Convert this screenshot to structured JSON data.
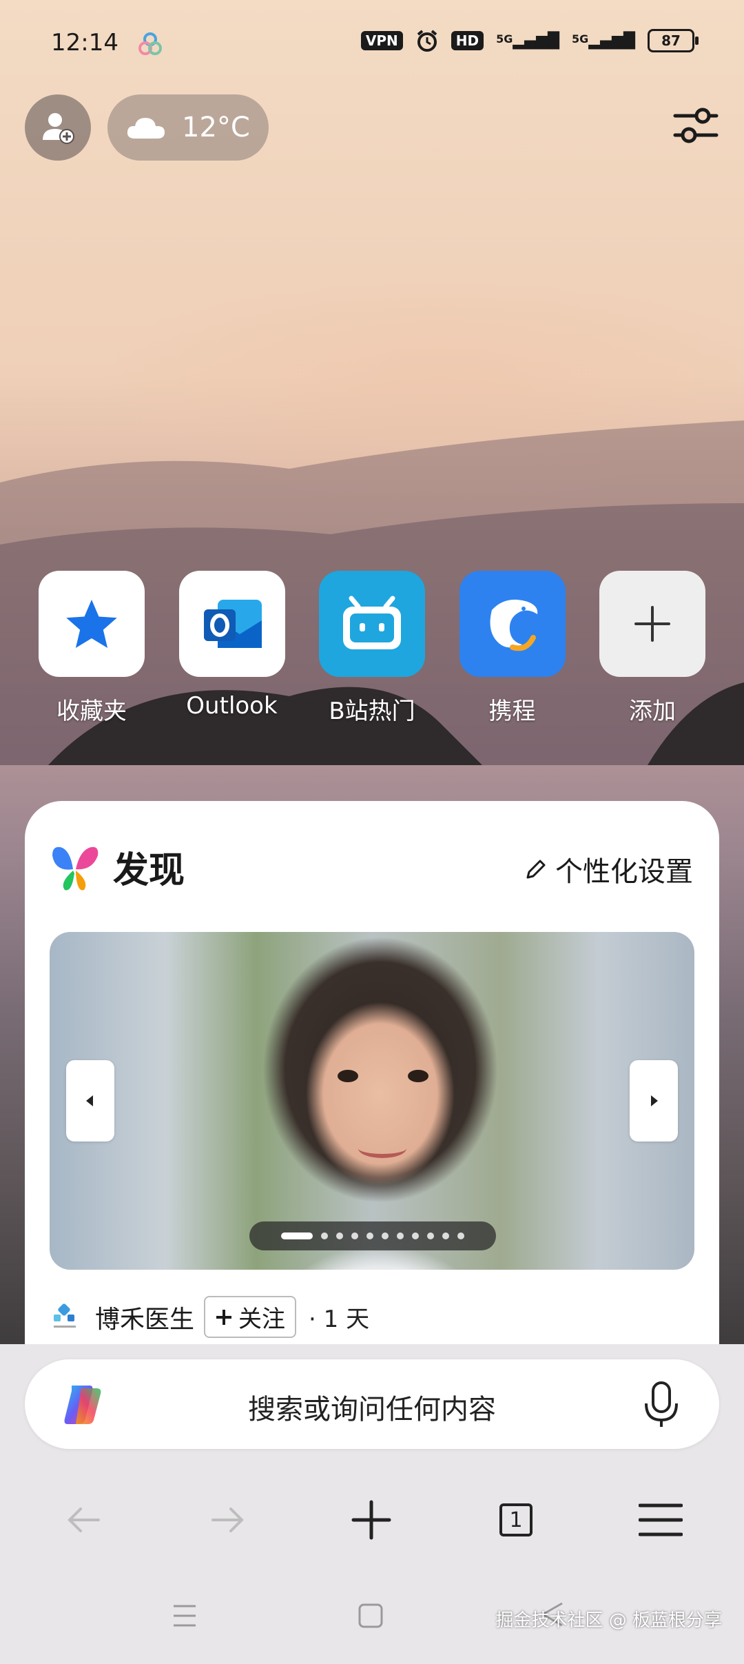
{
  "status_bar": {
    "time": "12:14",
    "vpn": "VPN",
    "hd": "HD",
    "signal1": "5G",
    "signal2": "5G",
    "battery": "87"
  },
  "weather": {
    "temp": "12°C",
    "icon": "cloud-icon"
  },
  "shortcuts": [
    {
      "label": "收藏夹",
      "icon": "star-icon",
      "bg": "#ffffff",
      "fg": "#1a73e8"
    },
    {
      "label": "Outlook",
      "icon": "outlook-icon",
      "bg": "#ffffff",
      "fg": "#0a64c8"
    },
    {
      "label": "B站热门",
      "icon": "bilibili-icon",
      "bg": "#1fa6de",
      "fg": "#ffffff"
    },
    {
      "label": "携程",
      "icon": "ctrip-dolphin-icon",
      "bg": "#2d82f0",
      "fg": "#ffffff"
    },
    {
      "label": "添加",
      "icon": "plus-icon",
      "bg": "#efeeef",
      "fg": "#333333"
    }
  ],
  "discover": {
    "title": "发现",
    "personalize": "个性化设置",
    "carousel": {
      "slides": 11,
      "active_index": 1
    },
    "source_name": "博禾医生",
    "follow_label": "关注",
    "age": "· 1 天"
  },
  "search": {
    "placeholder": "搜索或询问任何内容"
  },
  "toolbar": {
    "tabs_count": "1"
  },
  "watermark": "掘金技术社区 @ 板蓝根分享"
}
